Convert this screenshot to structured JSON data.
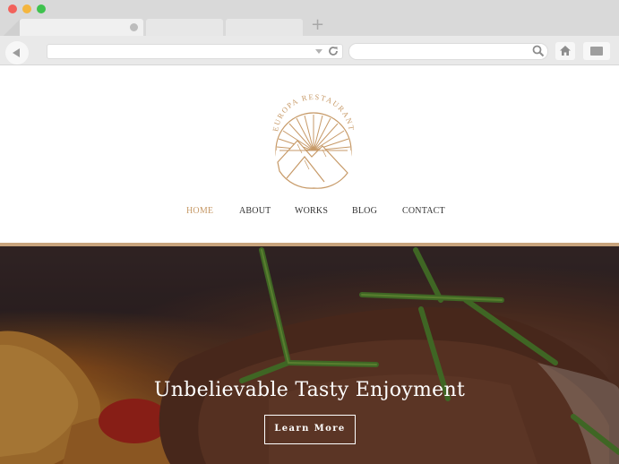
{
  "window": {
    "controls": [
      "close",
      "minimize",
      "zoom"
    ],
    "colors": {
      "close": "#f2625b",
      "minimize": "#f4b63f",
      "zoom": "#3fc24e"
    }
  },
  "tabs": [
    {
      "label": "",
      "active": true
    },
    {
      "label": "",
      "active": false
    },
    {
      "label": "",
      "active": false
    }
  ],
  "new_tab_symbol": "+",
  "toolbar": {
    "url_value": "",
    "search_value": "",
    "icons": [
      "back-icon",
      "dropdown-arrow-icon",
      "reload-icon",
      "search-icon",
      "home-icon",
      "menu-icon"
    ]
  },
  "site": {
    "logo_text": "EUROPA RESTAURANT",
    "accent_color": "#c79a68",
    "nav": [
      {
        "label": "HOME",
        "active": true
      },
      {
        "label": "ABOUT",
        "active": false
      },
      {
        "label": "WORKS",
        "active": false
      },
      {
        "label": "BLOG",
        "active": false
      },
      {
        "label": "CONTACT",
        "active": false
      }
    ]
  },
  "hero": {
    "title": "Unbelievable Tasty Enjoyment",
    "button_label": "Learn More"
  }
}
